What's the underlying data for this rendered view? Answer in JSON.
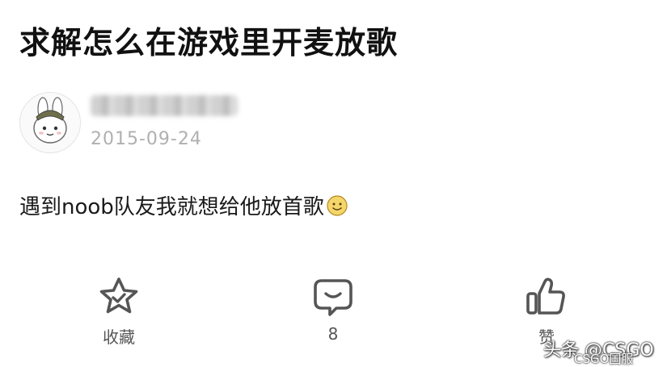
{
  "post": {
    "title": "求解怎么在游戏里开麦放歌",
    "date": "2015-09-24",
    "content": "遇到noob队友我就想给他放首歌",
    "content_emoji": "smile-emoji-icon"
  },
  "actions": {
    "collect_label": "收藏",
    "comment_count": "8",
    "like_label": "赞"
  },
  "watermark": {
    "main": "头条 @CSGO",
    "sub": "CSGO国服"
  },
  "colors": {
    "text": "#1a1a1a",
    "muted": "#b0b0b0",
    "icon": "#555555"
  }
}
